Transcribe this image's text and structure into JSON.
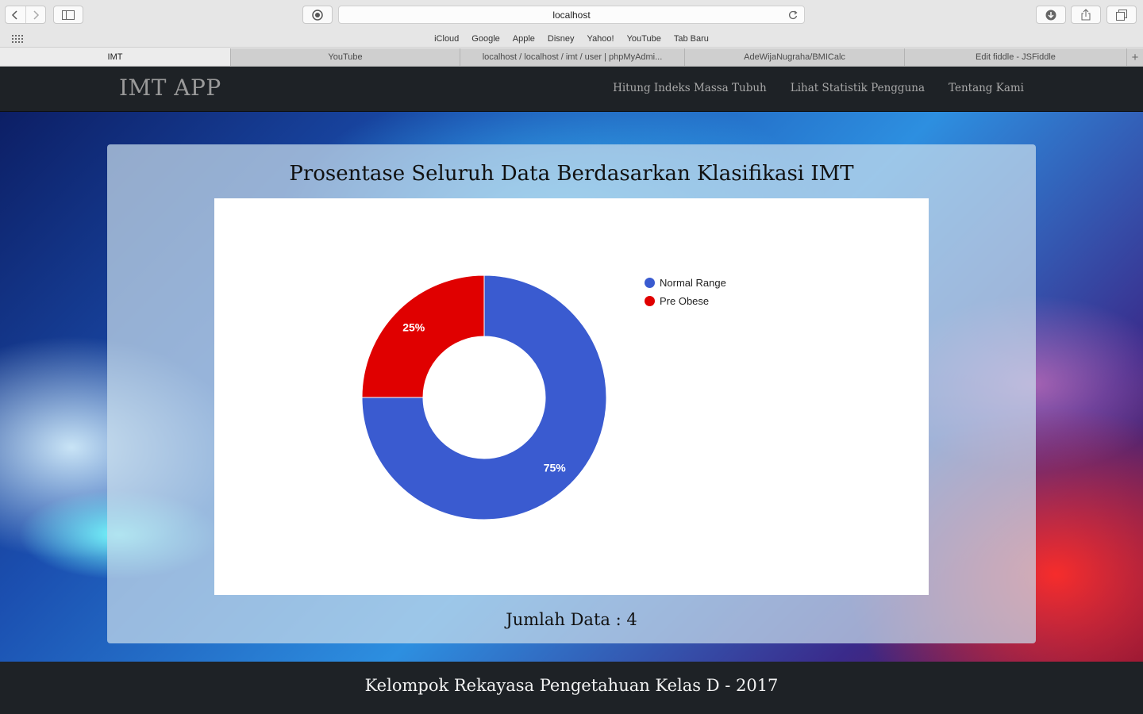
{
  "browser": {
    "address": "localhost",
    "favorites": [
      "iCloud",
      "Google",
      "Apple",
      "Disney",
      "Yahoo!",
      "YouTube",
      "Tab Baru"
    ],
    "tabs": [
      {
        "label": "IMT",
        "active": true
      },
      {
        "label": "YouTube",
        "active": false
      },
      {
        "label": "localhost / localhost / imt / user | phpMyAdmi...",
        "active": false
      },
      {
        "label": "AdeWijaNugraha/BMICalc",
        "active": false
      },
      {
        "label": "Edit fiddle - JSFiddle",
        "active": false
      }
    ]
  },
  "navbar": {
    "brand": "IMT APP",
    "links": [
      "Hitung Indeks Massa Tubuh",
      "Lihat Statistik Pengguna",
      "Tentang Kami"
    ]
  },
  "panel": {
    "title": "Prosentase Seluruh Data Berdasarkan Klasifikasi IMT",
    "count_text": "Jumlah Data : 4"
  },
  "chart_data": {
    "type": "pie",
    "donut": true,
    "categories": [
      "Normal Range",
      "Pre Obese"
    ],
    "values": [
      75,
      25
    ],
    "labels": [
      "75%",
      "25%"
    ],
    "colors": [
      "#3a5bd0",
      "#e00000"
    ],
    "legend": "right"
  },
  "footer": {
    "text": "Kelompok Rekayasa Pengetahuan Kelas D - 2017"
  }
}
